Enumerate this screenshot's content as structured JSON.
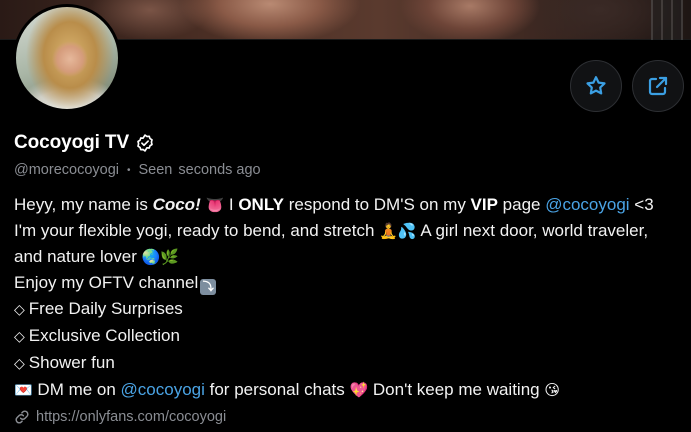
{
  "profile": {
    "name": "Cocoyogi TV",
    "handle": "@morecocoyogi",
    "seen_label": "Seen",
    "seen_time": "seconds ago",
    "link": "https://onlyfans.com/cocoyogi"
  },
  "actions": {
    "favorite_icon": "star-icon",
    "share_icon": "share-icon"
  },
  "bio": {
    "l1_a": "Heyy, my name is ",
    "l1_name": "Coco!",
    "l1_emoji": "👅",
    "l1_b": " I ",
    "l1_only": "ONLY",
    "l1_c": " respond to DM'S on my ",
    "l1_vip": "VIP",
    "l1_d": " page ",
    "l1_mention": "@cocoyogi",
    "l1_e": " <3",
    "l2_a": "I'm your flexible yogi, ready to bend, and stretch ",
    "l2_emoji1": "🧘",
    "l2_emoji2": "💦",
    "l2_b": " A girl next door, world traveler,",
    "l3_a": "and nature lover ",
    "l3_emoji1": "🌏",
    "l3_emoji2": "🌿",
    "l4_a": "Enjoy my OFTV channel",
    "l4_emoji": "⤵",
    "l5": "Free Daily Surprises",
    "l6": "Exclusive Collection",
    "l7": "Shower fun",
    "l8_emoji1": "💌",
    "l8_a": " DM me on ",
    "l8_mention": "@cocoyogi",
    "l8_b": " for personal chats ",
    "l8_emoji2": "💖",
    "l8_c": " Don't keep me waiting ",
    "l8_emoji3": "😘",
    "diamond": "◇"
  },
  "colors": {
    "background": "#000000",
    "mention": "#4aa3e4",
    "accent": "#3b9fe3",
    "muted": "#8a8d93"
  }
}
